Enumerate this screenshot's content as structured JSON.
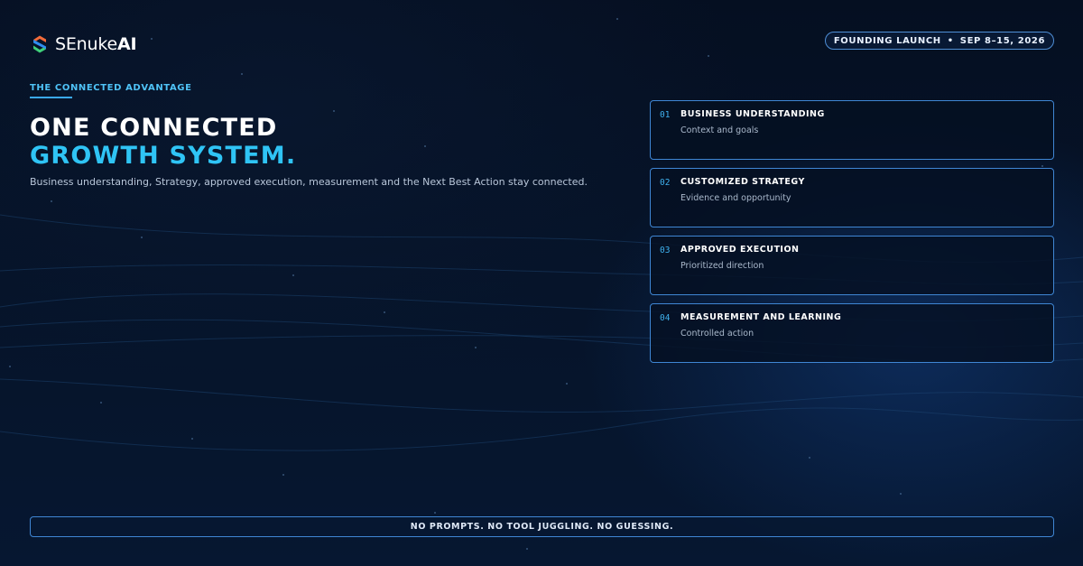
{
  "brand": {
    "name_regular": "SEnuke",
    "name_bold": "AI",
    "colors": {
      "accent": "#2fc4f5",
      "mark_orange": "#f26b3a",
      "mark_blue": "#2f8df0",
      "mark_green": "#3fcf7a"
    }
  },
  "launch_badge": {
    "label": "FOUNDING LAUNCH",
    "separator": "•",
    "dates": "SEP 8–15, 2026"
  },
  "eyebrow": "THE CONNECTED ADVANTAGE",
  "headline": {
    "line1": "ONE CONNECTED",
    "line2": "GROWTH SYSTEM."
  },
  "subtext": "Business understanding, Strategy, approved execution, measurement and the Next Best Action stay connected.",
  "steps": [
    {
      "number": "01",
      "title": "BUSINESS UNDERSTANDING",
      "description": "Context and goals"
    },
    {
      "number": "02",
      "title": "CUSTOMIZED STRATEGY",
      "description": "Evidence and opportunity"
    },
    {
      "number": "03",
      "title": "APPROVED EXECUTION",
      "description": "Prioritized direction"
    },
    {
      "number": "04",
      "title": "MEASUREMENT AND LEARNING",
      "description": "Controlled action"
    }
  ],
  "footer_banner": "NO PROMPTS. NO TOOL JUGGLING. NO GUESSING."
}
